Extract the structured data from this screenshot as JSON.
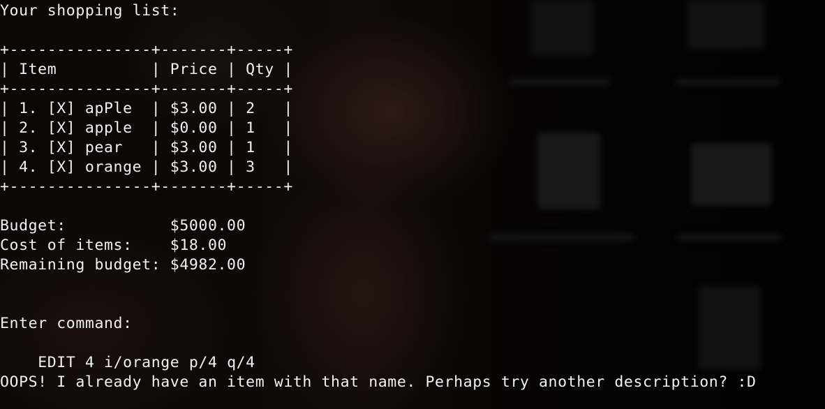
{
  "terminal": {
    "heading": "Your shopping list:",
    "table": {
      "border": "+---------------+-------+-----+",
      "header_row": "| Item          | Price | Qty |",
      "rows": [
        "| 1. [X] apPle  | $3.00 | 2   |",
        "| 2. [X] apple  | $0.00 | 1   |",
        "| 3. [X] pear   | $3.00 | 1   |",
        "| 4. [X] orange | $3.00 | 3   |"
      ]
    },
    "summary": {
      "budget": "Budget:           $5000.00",
      "cost": "Cost of items:    $18.00",
      "remaining": "Remaining budget: $4982.00"
    },
    "prompt": "Enter command:",
    "command_value": "EDIT 4 i/orange p/4 q/4",
    "error_message": "OOPS! I already have an item with that name. Perhaps try another description? :D"
  }
}
